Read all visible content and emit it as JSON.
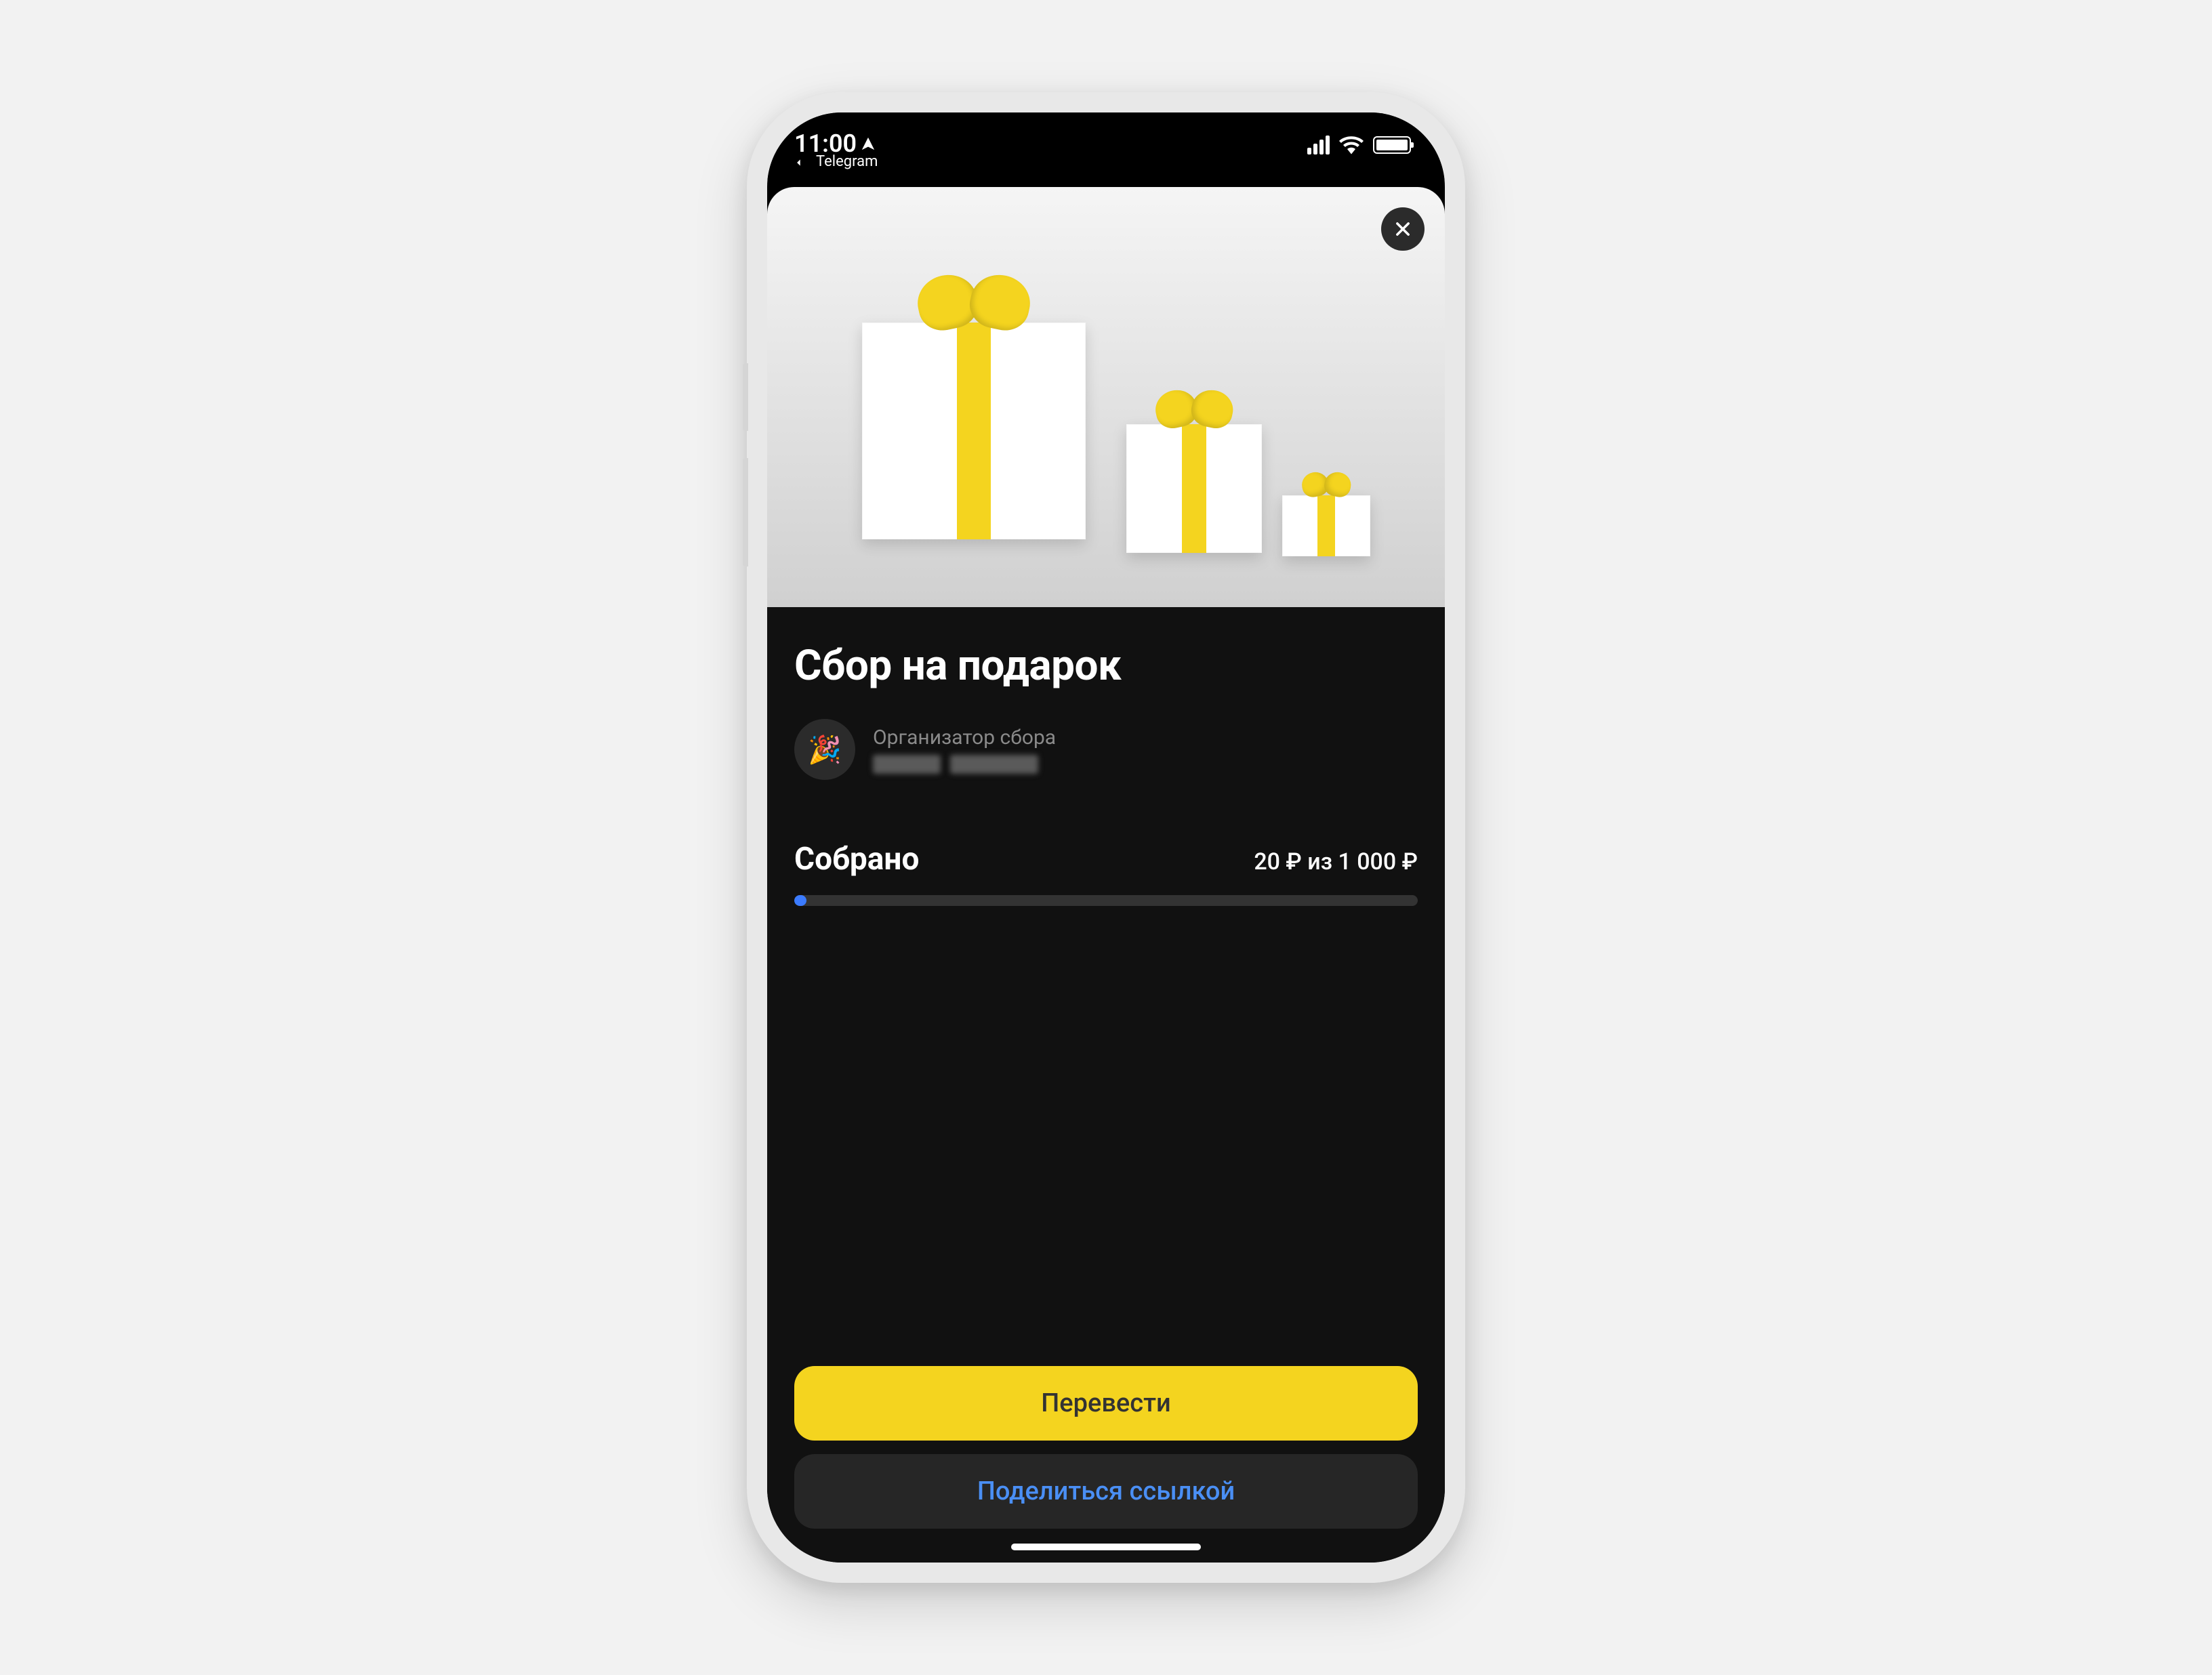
{
  "statusBar": {
    "time": "11:00",
    "backApp": "Telegram"
  },
  "modal": {
    "title": "Сбор на подарок",
    "organizer": {
      "label": "Организатор сбора",
      "avatarEmoji": "🎉"
    },
    "collected": {
      "label": "Собрано",
      "amountText": "20 ₽ из 1 000 ₽",
      "current": 20,
      "goal": 1000,
      "progressPercent": 2
    },
    "buttons": {
      "primary": "Перевести",
      "secondary": "Поделиться ссылкой"
    }
  },
  "colors": {
    "accent": "#F4D41F",
    "link": "#4A8FF5",
    "progress": "#3B7BFF",
    "background": "#111111"
  }
}
